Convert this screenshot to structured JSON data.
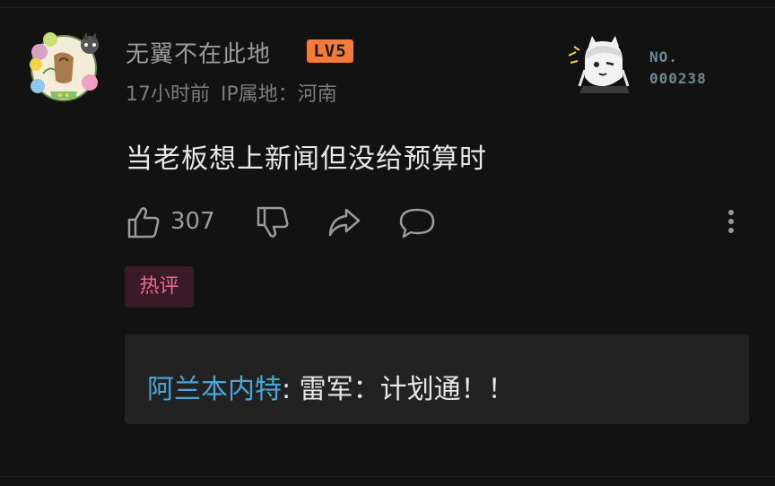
{
  "user": {
    "name": "无翼不在此地",
    "level": "LV5",
    "time": "17小时前",
    "ip_location": "IP属地：河南"
  },
  "fan_badge": {
    "label": "NO.",
    "number": "000238"
  },
  "comment": {
    "text": "当老板想上新闻但没给预算时"
  },
  "actions": {
    "like_count": "307"
  },
  "tag": {
    "label": "热评"
  },
  "reply": {
    "user": "阿兰本内特",
    "separator": ": ",
    "text": "雷军：计划通！！"
  },
  "colors": {
    "background": "#121212",
    "level_badge": "#f27a3a",
    "hot_tag_text": "#ea6a93",
    "hot_tag_bg": "#3a1a26",
    "reply_user": "#4aa6d8"
  },
  "icons": [
    "avatar-image",
    "fan-badge-image",
    "thumbs-up-icon",
    "thumbs-down-icon",
    "share-icon",
    "comment-icon",
    "more-vertical-icon"
  ]
}
